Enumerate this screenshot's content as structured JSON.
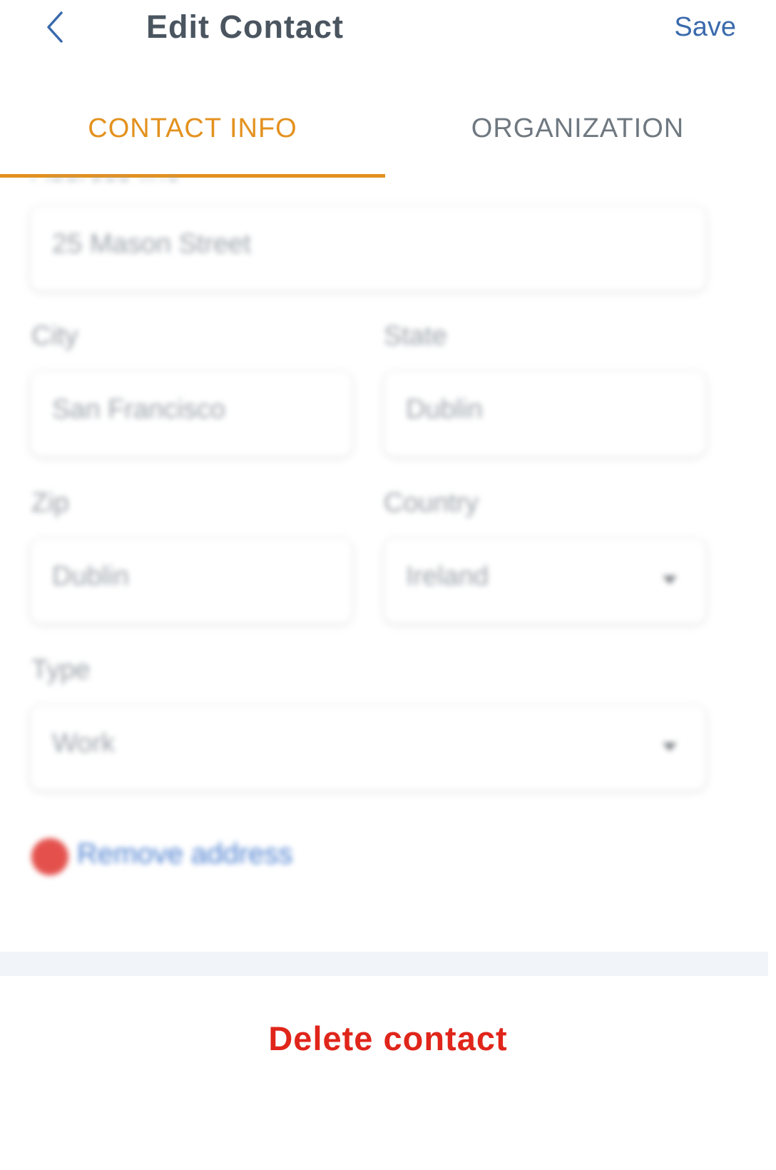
{
  "header": {
    "title": "Edit Contact",
    "save_label": "Save",
    "back_icon": "chevron-left-icon"
  },
  "tabs": [
    {
      "label": "CONTACT INFO",
      "active": true
    },
    {
      "label": "ORGANIZATION",
      "active": false
    }
  ],
  "form": {
    "address_line": {
      "label": "Address line",
      "value": "25 Mason Street"
    },
    "city": {
      "label": "City",
      "value": "San Francisco"
    },
    "state": {
      "label": "State",
      "value": "Dublin"
    },
    "zip": {
      "label": "Zip",
      "value": "Dublin"
    },
    "country": {
      "label": "Country",
      "value": "Ireland"
    },
    "type": {
      "label": "Type",
      "value": "Work"
    },
    "remove_address_label": "Remove address"
  },
  "footer": {
    "delete_label": "Delete contact"
  },
  "colors": {
    "accent_orange": "#e3911e",
    "link_blue": "#3a6aac",
    "danger_red": "#e0251b"
  }
}
